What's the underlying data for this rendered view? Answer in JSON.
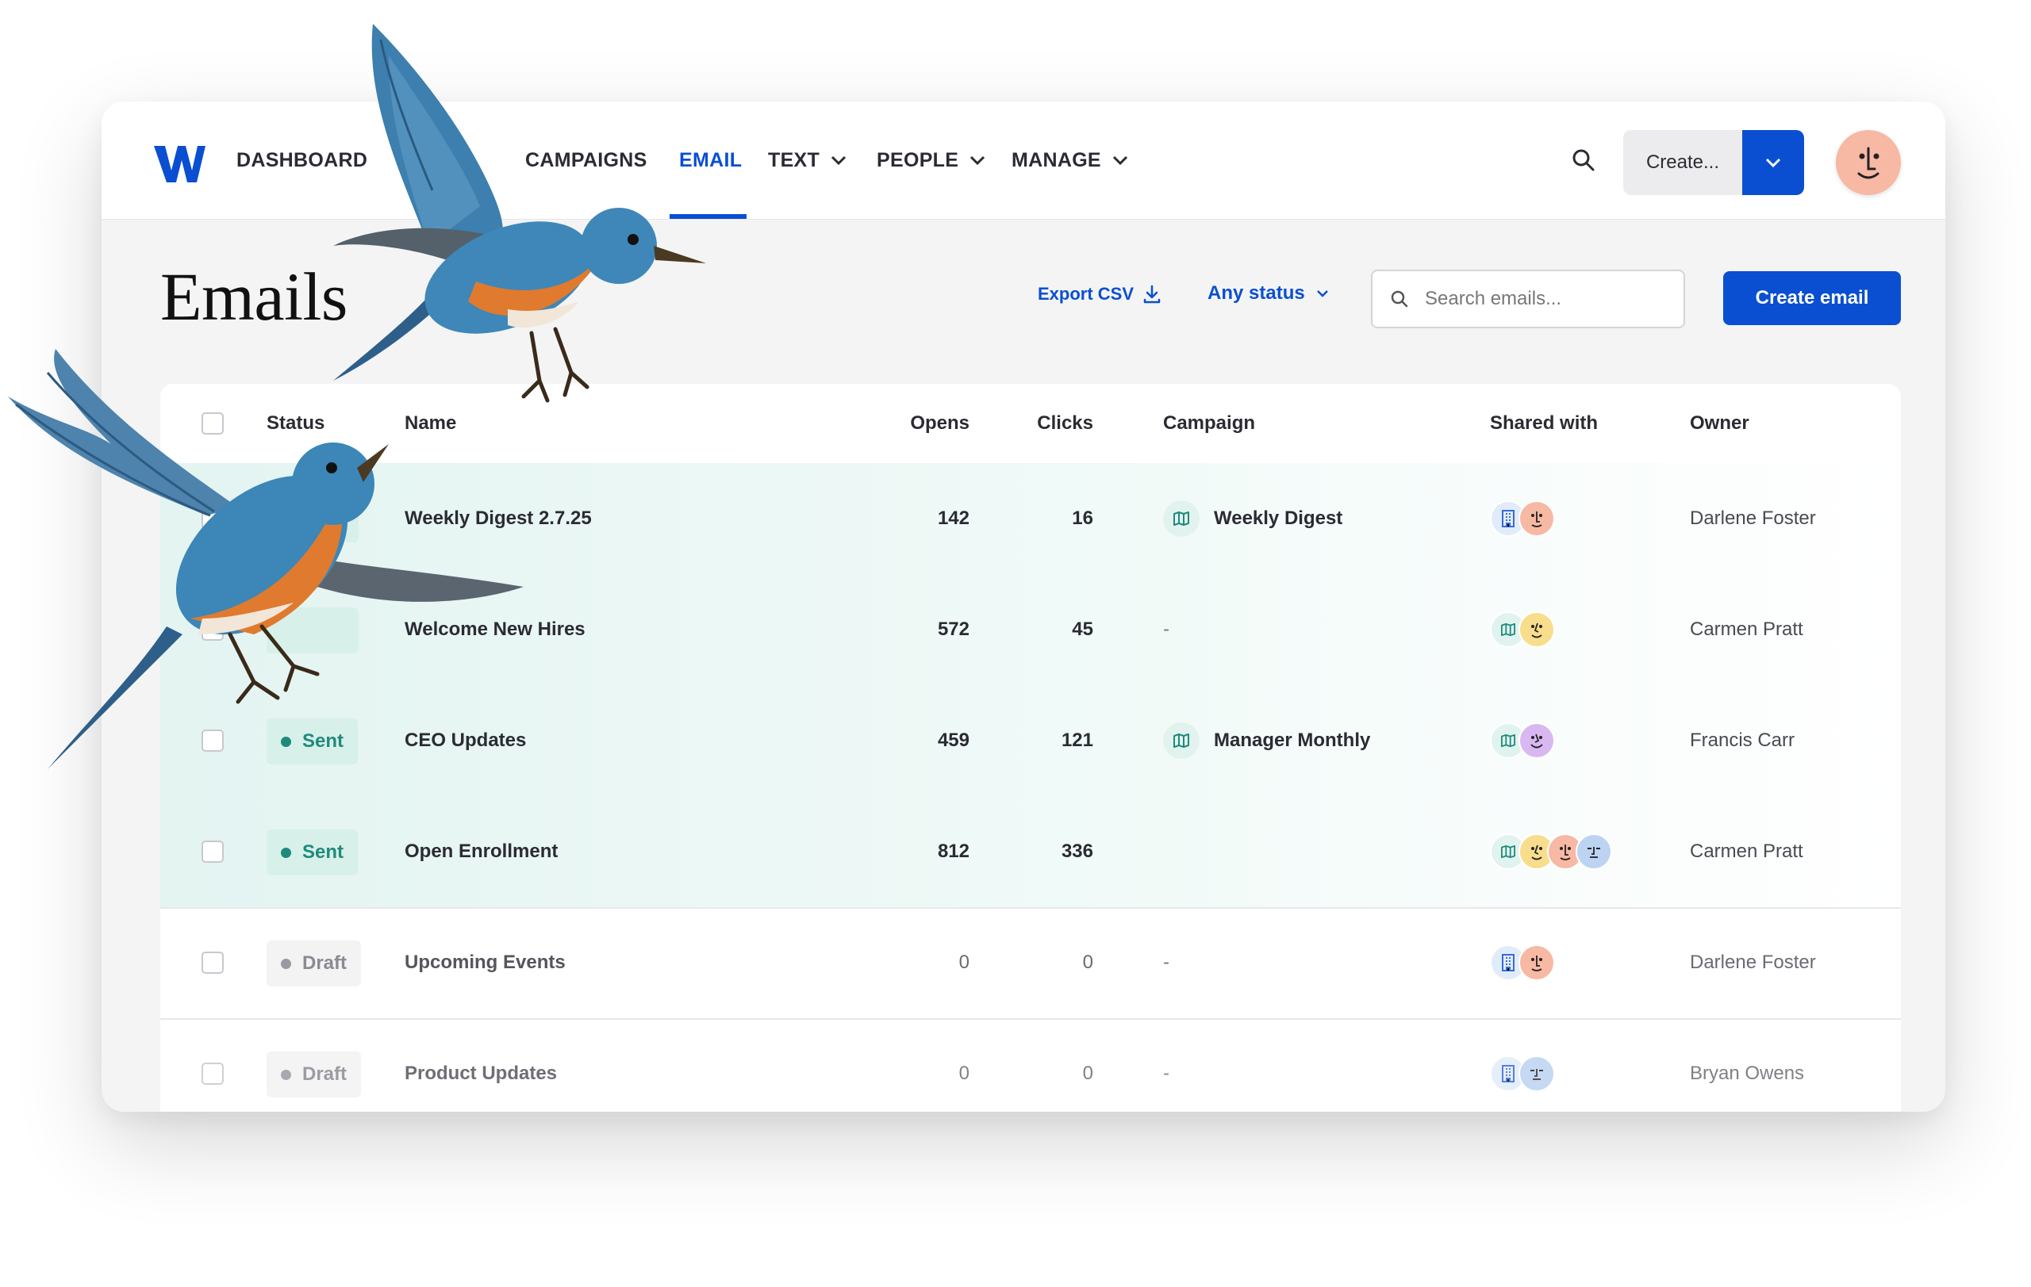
{
  "nav": {
    "logo": "W",
    "items": [
      {
        "label": "DASHBOARD",
        "dropdown": false,
        "active": false
      },
      {
        "label": "CAMPAIGNS",
        "dropdown": false,
        "active": false
      },
      {
        "label": "EMAIL",
        "dropdown": false,
        "active": true
      },
      {
        "label": "TEXT",
        "dropdown": true,
        "active": false
      },
      {
        "label": "PEOPLE",
        "dropdown": true,
        "active": false
      },
      {
        "label": "MANAGE",
        "dropdown": true,
        "active": false
      }
    ],
    "search_icon": "search-icon",
    "create_label": "Create...",
    "create_dropdown_icon": "chevron-down-icon",
    "user_avatar": "avatar"
  },
  "header": {
    "title": "Emails",
    "export_label": "Export CSV",
    "status_filter": "Any status",
    "search_placeholder": "Search emails...",
    "create_email_label": "Create email"
  },
  "table": {
    "columns": [
      "Status",
      "Name",
      "Opens",
      "Clicks",
      "Campaign",
      "Shared with",
      "Owner"
    ],
    "rows": [
      {
        "status": "",
        "name": "Weekly Digest 2.7.25",
        "opens": "142",
        "clicks": "16",
        "campaign": "Weekly Digest",
        "shared": [
          "org",
          "person-peach"
        ],
        "owner": "Darlene Foster"
      },
      {
        "status": "",
        "name": "Welcome New Hires",
        "opens": "572",
        "clicks": "45",
        "campaign": "-",
        "shared": [
          "campaign",
          "person-yellow"
        ],
        "owner": "Carmen Pratt"
      },
      {
        "status": "Sent",
        "name": "CEO Updates",
        "opens": "459",
        "clicks": "121",
        "campaign": "Manager Monthly",
        "shared": [
          "campaign",
          "person-purple"
        ],
        "owner": "Francis Carr"
      },
      {
        "status": "Sent",
        "name": "Open Enrollment",
        "opens": "812",
        "clicks": "336",
        "campaign": "",
        "shared": [
          "campaign",
          "person-yellow",
          "person-peach",
          "person-blue"
        ],
        "owner": "Carmen Pratt"
      },
      {
        "status": "Draft",
        "name": "Upcoming Events",
        "opens": "0",
        "clicks": "0",
        "campaign": "-",
        "shared": [
          "org",
          "person-peach"
        ],
        "owner": "Darlene Foster"
      },
      {
        "status": "Draft",
        "name": "Product Updates",
        "opens": "0",
        "clicks": "0",
        "campaign": "-",
        "shared": [
          "org",
          "person-blue"
        ],
        "owner": "Bryan Owens"
      }
    ]
  },
  "colors": {
    "accent": "#0a4fd1",
    "sent": "#1f8a7c",
    "draft": "#8a8a92"
  },
  "decoration": [
    "bluebird-illustration",
    "bluebird-illustration"
  ]
}
